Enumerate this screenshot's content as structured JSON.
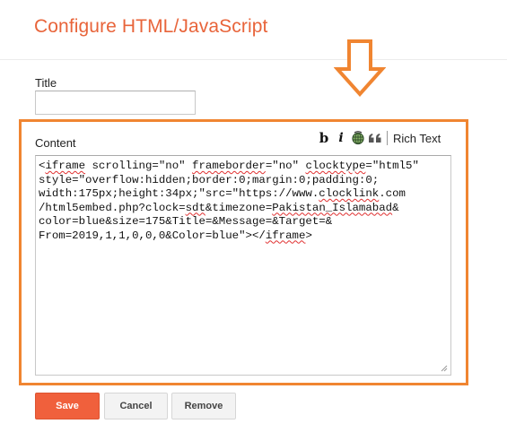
{
  "header": {
    "title": "Configure HTML/JavaScript"
  },
  "form": {
    "title_label": "Title",
    "title_value": "",
    "content_label": "Content",
    "content_lines": [
      [
        "<",
        {
          "s": "iframe"
        },
        " scrolling=\"no\" ",
        {
          "s": "frameborder"
        },
        "=\"no\" ",
        {
          "s": "clocktype"
        },
        "=\"html5\""
      ],
      [
        "style=\"overflow:hidden;border:0;margin:0;padding:0;"
      ],
      [
        "width:175px;height:34px;\"src=\"https://www.",
        {
          "s": "clocklink"
        },
        ".com"
      ],
      [
        "/html5embed.php?clock=",
        {
          "s": "sdt"
        },
        "&timezone=",
        {
          "s": "Pakistan_Islamabad"
        },
        "&"
      ],
      [
        "color=blue&size=175&Title=&Message=&Target=&"
      ],
      [
        "From=2019,1,1,0,0,0&Color=blue\"></",
        {
          "s": "iframe"
        },
        ">"
      ]
    ]
  },
  "toolbar": {
    "bold_label": "b",
    "italic_label": "i",
    "link_icon": "link-globe-icon",
    "quote_icon": "quote-icon",
    "rich_text_label": "Rich Text"
  },
  "buttons": {
    "save_label": "Save",
    "cancel_label": "Cancel",
    "remove_label": "Remove"
  },
  "colors": {
    "accent": "#e8643a",
    "highlight": "#f08531",
    "save_bg": "#f0603c"
  }
}
